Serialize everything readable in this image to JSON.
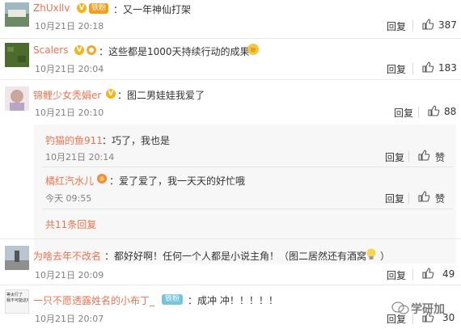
{
  "comments": [
    {
      "user": "ZhUxllv",
      "text": "：又一年神仙打架",
      "time": "10月21日 20:18",
      "reply": "回复",
      "likes": "387",
      "badge": "铁粉"
    },
    {
      "user": "Scalers",
      "text": "：这些都是1000天持续行动的成果",
      "time": "10月21日 20:04",
      "reply": "回复",
      "likes": "183"
    },
    {
      "user": "锦鲤少女秃娟er",
      "text": "：图二男娃娃我爱了",
      "time": "10月21日 20:10",
      "reply": "回复",
      "likes": "88"
    },
    {
      "user": "为啥去年不改名",
      "text": "：都好好啊！任何一个人都是小说主角！（图二居然还有酒窝",
      "time": "10月21日 20:09",
      "reply": "回复",
      "likes": "49"
    },
    {
      "user": "一只不愿透露姓名的小布丁_",
      "text": "：成冲 冲！！！！！",
      "time": "10月21日 20:07",
      "reply": "回复",
      "likes": "30",
      "badge": "铁粉"
    }
  ],
  "subcomments": [
    {
      "user": "钓猫的鱼911",
      "text": "：巧了，我也是",
      "time": "10月21日 20:14",
      "reply": "回复",
      "like_label": "赞"
    },
    {
      "user": "橘红汽水儿",
      "text": "：爱了爱了，我一天天的好忙哦",
      "time": "今天 09:55",
      "reply": "回复",
      "like_label": "赞"
    }
  ],
  "more_replies": "共11条回复",
  "watermark": "学研加",
  "avatar5_text": "等太行了\n我不可能这样"
}
